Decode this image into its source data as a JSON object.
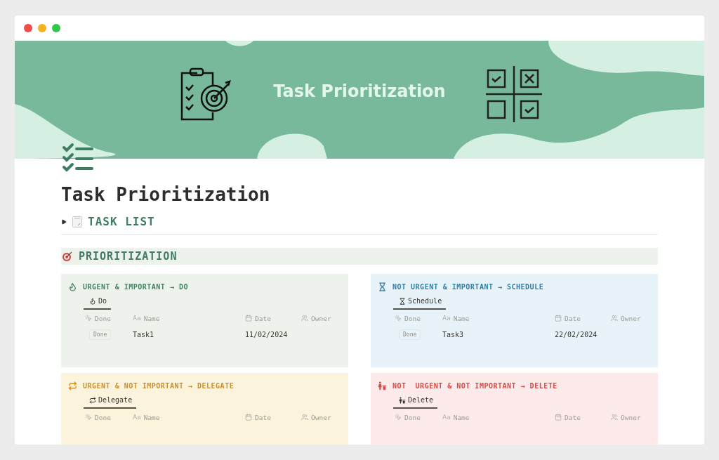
{
  "cover": {
    "title": "Task Prioritization"
  },
  "page": {
    "title": "Task Prioritization"
  },
  "toggle": {
    "label": "TASK LIST",
    "expanded": false
  },
  "section": {
    "title": "PRIORITIZATION"
  },
  "quadrants": [
    {
      "kind": "do",
      "title": "URGENT & IMPORTANT → DO",
      "view": "Do",
      "columns": [
        {
          "kind": "button",
          "label": "Done"
        },
        {
          "kind": "title",
          "prefix": "Aa",
          "label": "Name"
        },
        {
          "kind": "date",
          "label": "Date"
        },
        {
          "kind": "person",
          "label": "Owner"
        }
      ],
      "rows": [
        {
          "done": "Done",
          "name": "Task1",
          "date": "11/02/2024"
        }
      ]
    },
    {
      "kind": "schedule",
      "title": "NOT URGENT & IMPORTANT → SCHEDULE",
      "view": "Schedule",
      "columns": [
        {
          "kind": "button",
          "label": "Done"
        },
        {
          "kind": "title",
          "prefix": "Aa",
          "label": "Name"
        },
        {
          "kind": "date",
          "label": "Date"
        },
        {
          "kind": "person",
          "label": "Owner"
        }
      ],
      "rows": [
        {
          "done": "Done",
          "name": "Task3",
          "date": "22/02/2024"
        }
      ]
    },
    {
      "kind": "delegate",
      "title": "URGENT & NOT IMPORTANT → DELEGATE",
      "view": "Delegate",
      "columns": [
        {
          "kind": "button",
          "label": "Done"
        },
        {
          "kind": "title",
          "prefix": "Aa",
          "label": "Name"
        },
        {
          "kind": "date",
          "label": "Date"
        },
        {
          "kind": "person",
          "label": "Owner"
        }
      ]
    },
    {
      "kind": "delete",
      "title": "NOT  URGENT & NOT IMPORTANT → DELETE",
      "view": "Delete",
      "columns": [
        {
          "kind": "button",
          "label": "Done"
        },
        {
          "kind": "title",
          "prefix": "Aa",
          "label": "Name"
        },
        {
          "kind": "date",
          "label": "Date"
        },
        {
          "kind": "person",
          "label": "Owner"
        }
      ]
    }
  ]
}
